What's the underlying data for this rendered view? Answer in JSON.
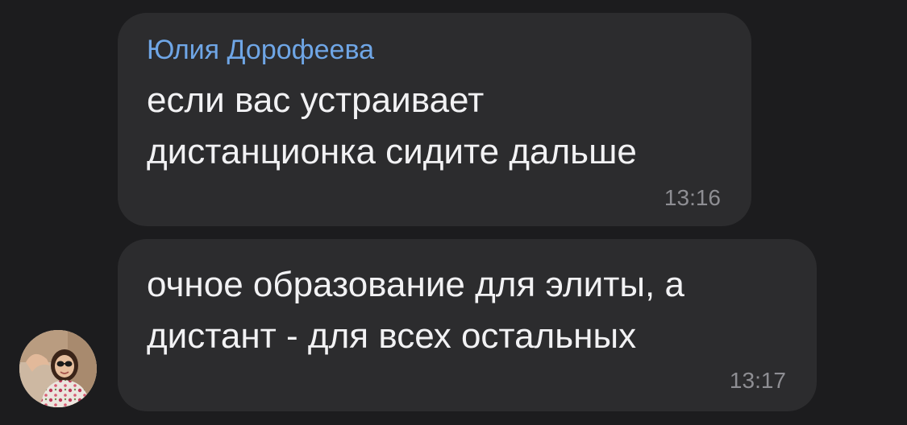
{
  "messages": [
    {
      "sender": "Юлия Дорофеева",
      "lines": [
        "если вас устраивает",
        "дистанционка сидите дальше"
      ],
      "time": "13:16"
    },
    {
      "sender": "",
      "lines": [
        "очное образование для элиты, а",
        "дистант - для всех остальных"
      ],
      "time": "13:17"
    }
  ],
  "colors": {
    "background": "#1c1c1e",
    "bubble": "#2c2c2e",
    "sender_name": "#6fa6e6",
    "message_text": "#f2f2f4",
    "timestamp": "#8e8e93"
  },
  "avatar": {
    "icon": "user-avatar-photo"
  }
}
